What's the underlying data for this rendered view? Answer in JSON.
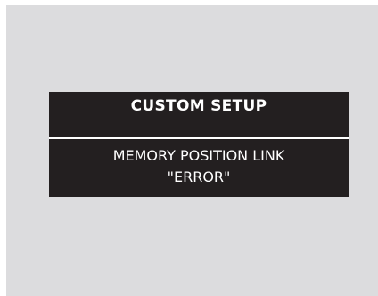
{
  "dialog": {
    "title": "CUSTOM SETUP",
    "message_line_1": "MEMORY POSITION LINK",
    "message_line_2": "\"ERROR\""
  },
  "colors": {
    "screen_background": "#dcdcde",
    "panel_background": "#231f20",
    "text": "#ffffff",
    "divider": "#ffffff"
  }
}
